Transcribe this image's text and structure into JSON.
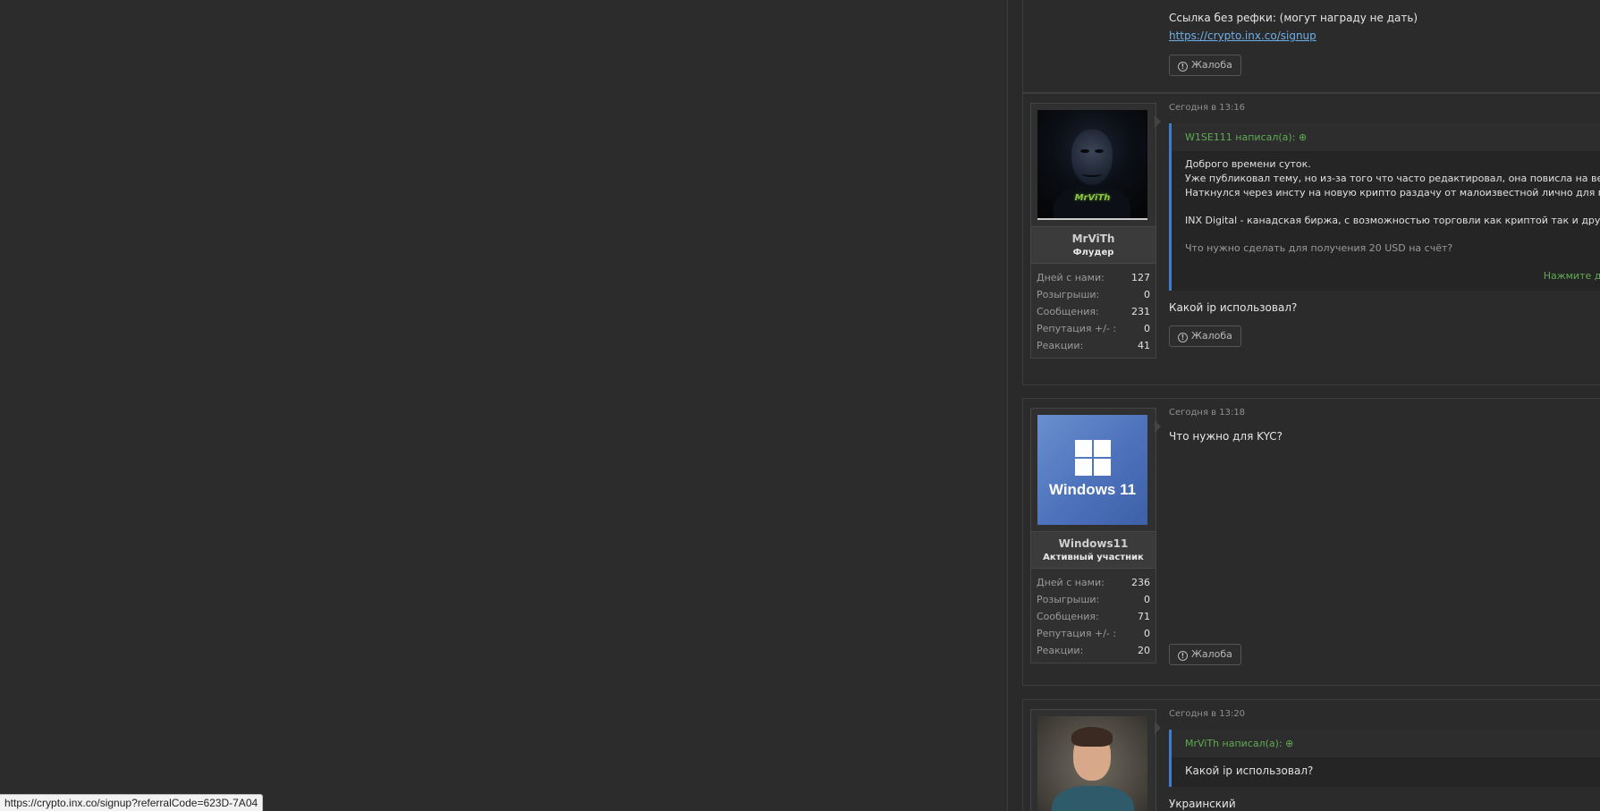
{
  "colors": {
    "accent_link": "#6eaee8",
    "quote_author": "#5faa52",
    "quote_bar": "#3d7dcc",
    "page_bg": "#2c2c2c"
  },
  "post0": {
    "text": "Ссылка без рефки: (могут награду не дать)",
    "link": "https://crypto.inx.co/signup",
    "report_label": "Жалоба",
    "report_icon": "alert-circle-icon"
  },
  "post1": {
    "time": "Сегодня в 13:16",
    "user": {
      "name": "MrViTh",
      "rank": "Флудер",
      "avatar_text": "MrViTh",
      "stats": [
        {
          "label": "Дней с нами:",
          "value": "127"
        },
        {
          "label": "Розыгрыши:",
          "value": "0"
        },
        {
          "label": "Сообщения:",
          "value": "231"
        },
        {
          "label": "Репутация +/- :",
          "value": "0"
        },
        {
          "label": "Реакции:",
          "value": "41"
        }
      ]
    },
    "quote": {
      "author": "W1SE111 написал(а):",
      "line1": "Доброго времени суток.",
      "line2": "Уже публиковал тему, но из-за того что часто редактировал, она повисла на вечной",
      "line3": "Наткнулся через инсту на новую крипто раздачу от малоизвестной лично для меня б",
      "line4": "INX Digital - канадская биржа, с возможностью торговли как криптой так и другими и",
      "line5": "Что нужно сделать для получения 20 USD на счёт?",
      "expand": "Нажмите для"
    },
    "text": "Какой ip использовал?",
    "report_label": "Жалоба"
  },
  "post2": {
    "time": "Сегодня в 13:18",
    "user": {
      "name": "Windows11",
      "rank": "Активный участник",
      "avatar_text": "Windows 11",
      "stats": [
        {
          "label": "Дней с нами:",
          "value": "236"
        },
        {
          "label": "Розыгрыши:",
          "value": "0"
        },
        {
          "label": "Сообщения:",
          "value": "71"
        },
        {
          "label": "Репутация +/- :",
          "value": "0"
        },
        {
          "label": "Реакции:",
          "value": "20"
        }
      ]
    },
    "text": "Что нужно для KYC?",
    "report_label": "Жалоба"
  },
  "post3": {
    "time": "Сегодня в 13:20",
    "quote": {
      "author": "MrViTh написал(а):",
      "line1": "Какой ip использовал?"
    },
    "text": "Украинский"
  },
  "statusbar": {
    "url": "https://crypto.inx.co/signup?referralCode=623D-7A04"
  }
}
